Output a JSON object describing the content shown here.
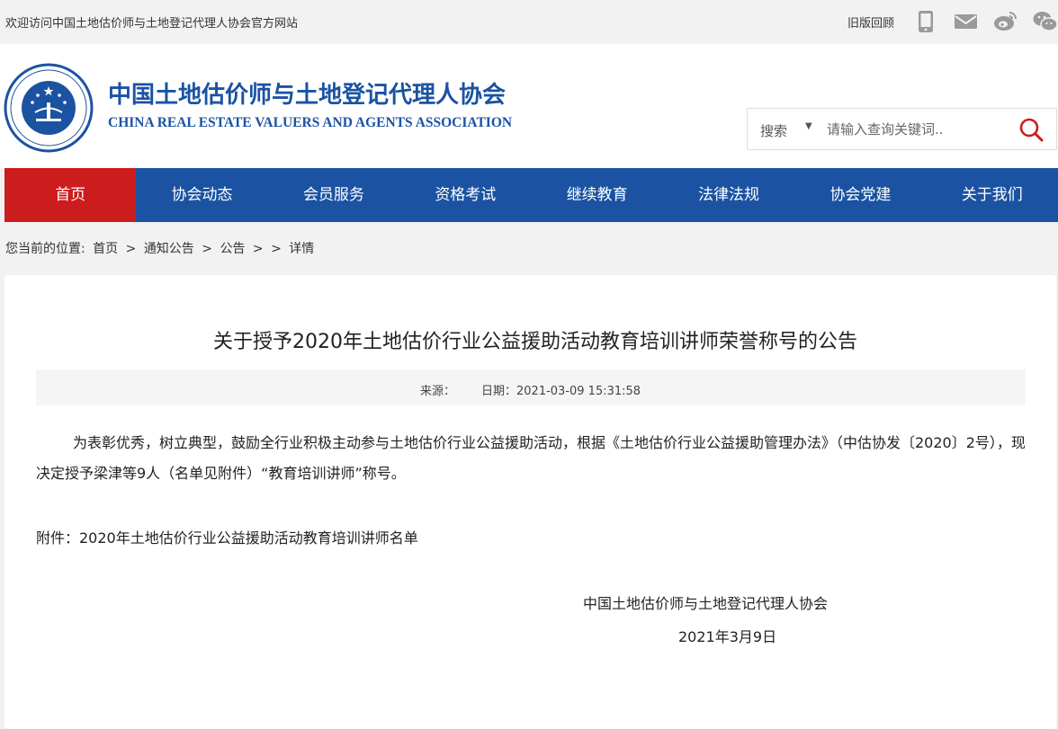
{
  "topbar": {
    "welcome": "欢迎访问中国土地估价师与土地登记代理人协会官方网站",
    "old_version": "旧版回顾",
    "icons": [
      "phone-icon",
      "mail-icon",
      "weibo-icon",
      "wechat-icon"
    ]
  },
  "header": {
    "org_name_cn": "中国土地估价师与土地登记代理人协会",
    "org_name_en": "CHINA REAL ESTATE VALUERS AND AGENTS ASSOCIATION",
    "search": {
      "selected": "搜索",
      "placeholder": "请输入查询关键词.."
    }
  },
  "colors": {
    "brand_blue": "#1b53a2",
    "active_red": "#cc1c1d"
  },
  "nav": {
    "items": [
      "首页",
      "协会动态",
      "会员服务",
      "资格考试",
      "继续教育",
      "法律法规",
      "协会党建",
      "关于我们"
    ],
    "active": "首页"
  },
  "breadcrumb": {
    "prefix": "您当前的位置:",
    "items": [
      "首页",
      ">",
      "通知公告",
      ">",
      "公告",
      ">",
      ">",
      "详情"
    ]
  },
  "article": {
    "title": "关于授予2020年土地估价行业公益援助活动教育培训讲师荣誉称号的公告",
    "source_label": "来源：",
    "date_label": "日期：2021-03-09 15:31:58",
    "paragraph": "为表彰优秀，树立典型，鼓励全行业积极主动参与土地估价行业公益援助活动，根据《土地估价行业公益援助管理办法》（中估协发〔2020〕2号），现决定授予梁津等9人（名单见附件）“教育培训讲师”称号。",
    "attachment": "附件：2020年土地估价行业公益援助活动教育培训讲师名单",
    "signature": "中国土地估价师与土地登记代理人协会",
    "sign_date": "2021年3月9日"
  }
}
